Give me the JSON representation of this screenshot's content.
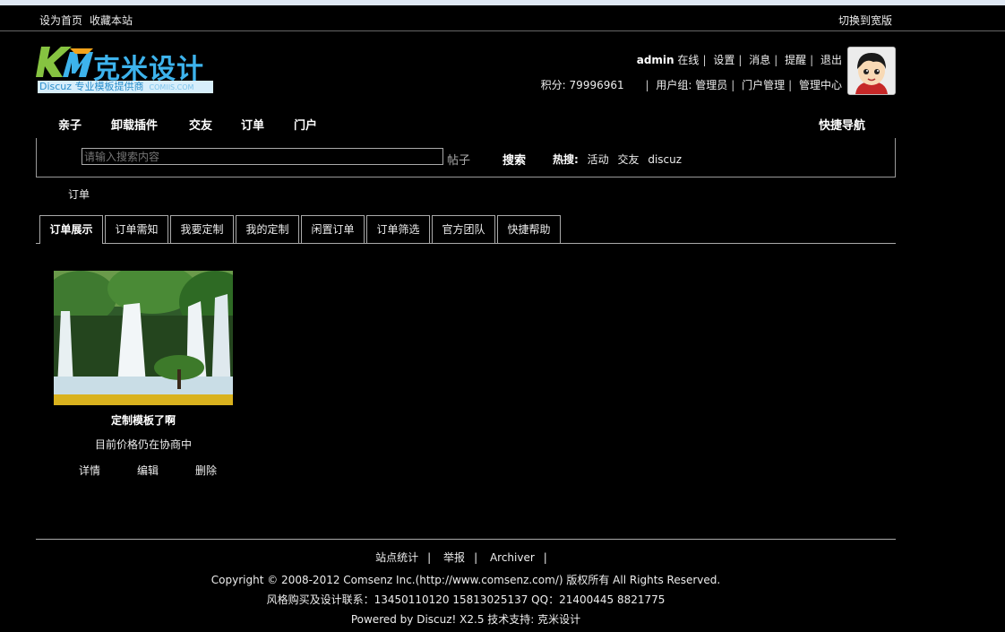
{
  "toolbar": {
    "set_home": "设为首页",
    "bookmark": "收藏本站",
    "switch_width": "切换到宽版"
  },
  "logo": {
    "brand": "克米设计",
    "tagline": "Discuz 专业模板提供商",
    "domain": "COMIIS.COM"
  },
  "user": {
    "name": "admin",
    "status": "在线",
    "links": [
      "设置",
      "消息",
      "提醒",
      "退出"
    ],
    "points_label": "积分:",
    "points_value": "79996961",
    "group_label": "用户组:",
    "group_value": "管理员",
    "portal_manage": "门户管理",
    "admin_center": "管理中心"
  },
  "nav": {
    "items": [
      "亲子",
      "卸载插件",
      "交友",
      "订单",
      "门户"
    ],
    "quick_nav": "快捷导航"
  },
  "search": {
    "placeholder": "请输入搜索内容",
    "scope": "帖子",
    "button": "搜索",
    "hot_label": "热搜:",
    "hot_items": [
      "活动",
      "交友",
      "discuz"
    ]
  },
  "breadcrumb": "订单",
  "tabs": [
    "订单展示",
    "订单需知",
    "我要定制",
    "我的定制",
    "闲置订单",
    "订单筛选",
    "官方团队",
    "快捷帮助"
  ],
  "card": {
    "title": "定制模板了啊",
    "price": "目前价格仍在协商中",
    "actions": [
      "详情",
      "编辑",
      "删除"
    ]
  },
  "footer": {
    "links": [
      "站点统计",
      "举报",
      "Archiver"
    ],
    "copyright": "Copyright © 2008-2012 Comsenz Inc.(http://www.comsenz.com/) 版权所有 All Rights Reserved.",
    "contact": "风格购买及设计联系：13450110120 15813025137 QQ：21400445 8821775",
    "powered": "Powered by Discuz! X2.5  技术支持: 克米设计"
  },
  "colors": {
    "background": "#000000",
    "text": "#ffffff",
    "logo_blue": "#3db3ec",
    "border": "#aaaaaa"
  }
}
